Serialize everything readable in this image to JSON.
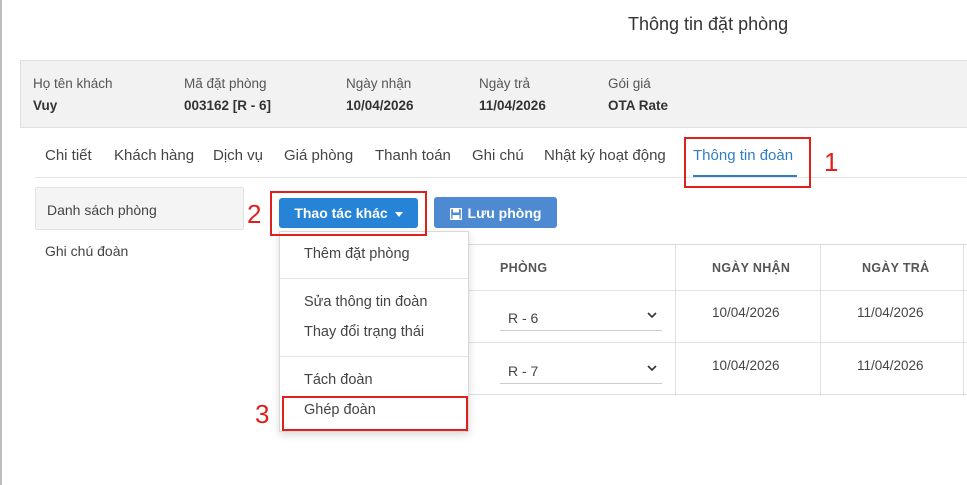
{
  "dialog": {
    "title": "Thông tin đặt phòng"
  },
  "booking": {
    "guest_label": "Họ tên khách",
    "guest_value": "Vuy",
    "code_label": "Mã đặt phòng",
    "code_value": "003162 [R - 6]",
    "checkin_label": "Ngày nhận",
    "checkin_value": "10/04/2026",
    "checkout_label": "Ngày trả",
    "checkout_value": "11/04/2026",
    "rate_label": "Gói giá",
    "rate_value": "OTA Rate"
  },
  "tabs": [
    {
      "label": "Chi tiết"
    },
    {
      "label": "Khách hàng"
    },
    {
      "label": "Dịch vụ"
    },
    {
      "label": "Giá phòng"
    },
    {
      "label": "Thanh toán"
    },
    {
      "label": "Ghi chú"
    },
    {
      "label": "Nhật ký hoạt động"
    },
    {
      "label": "Thông tin đoàn"
    }
  ],
  "sidebar": {
    "room_list": "Danh sách phòng",
    "group_note": "Ghi chú đoàn"
  },
  "toolbar": {
    "actions_label": "Thao tác khác",
    "save_label": "Lưu phòng"
  },
  "menu": {
    "add_booking": "Thêm đặt phòng",
    "edit_group": "Sửa thông tin đoàn",
    "change_status": "Thay đổi trạng thái",
    "split_group": "Tách đoàn",
    "merge_group": "Ghép đoàn"
  },
  "table": {
    "headers": {
      "room": "PHÒNG",
      "checkin": "NGÀY NHẬN",
      "checkout": "NGÀY TRẢ"
    },
    "rows": [
      {
        "room": "R - 6",
        "checkin": "10/04/2026",
        "checkout": "11/04/2026"
      },
      {
        "room": "R - 7",
        "checkin": "10/04/2026",
        "checkout": "11/04/2026"
      }
    ]
  },
  "annotations": {
    "n1": "1",
    "n2": "2",
    "n3": "3"
  },
  "colors": {
    "accent": "#2683d5",
    "annotation": "#e0201b"
  }
}
